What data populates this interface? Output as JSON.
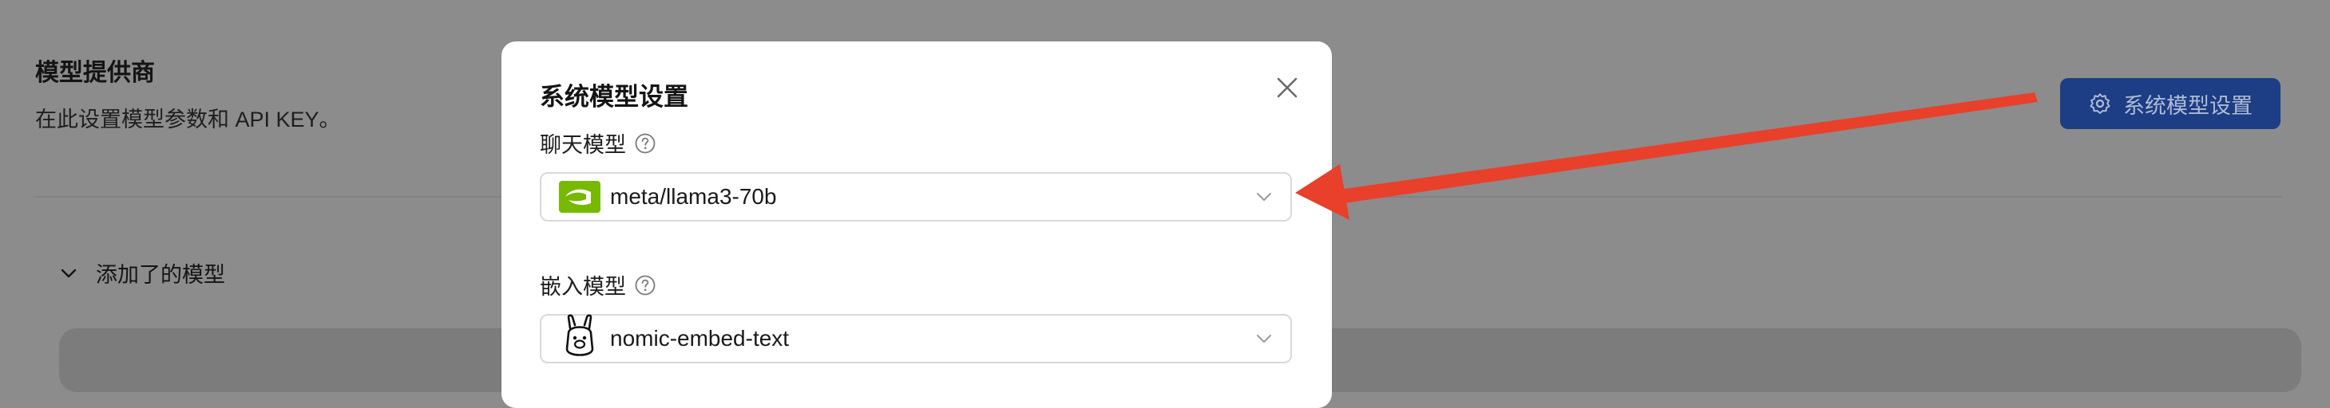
{
  "page": {
    "title": "模型提供商",
    "subtitle": "在此设置模型参数和 API KEY。",
    "section_label": "添加了的模型",
    "system_settings_button": "系统模型设置"
  },
  "modal": {
    "title": "系统模型设置",
    "fields": [
      {
        "label": "聊天模型",
        "value": "meta/llama3-70b",
        "logo": "nvidia-logo"
      },
      {
        "label": "嵌入模型",
        "value": "nomic-embed-text",
        "logo": "ollama-logo"
      }
    ]
  },
  "colors": {
    "overlay": "#8c8c8c",
    "primary_button": "#1d3d84",
    "annotation_arrow": "#e8402a",
    "nvidia_green": "#76b900"
  }
}
